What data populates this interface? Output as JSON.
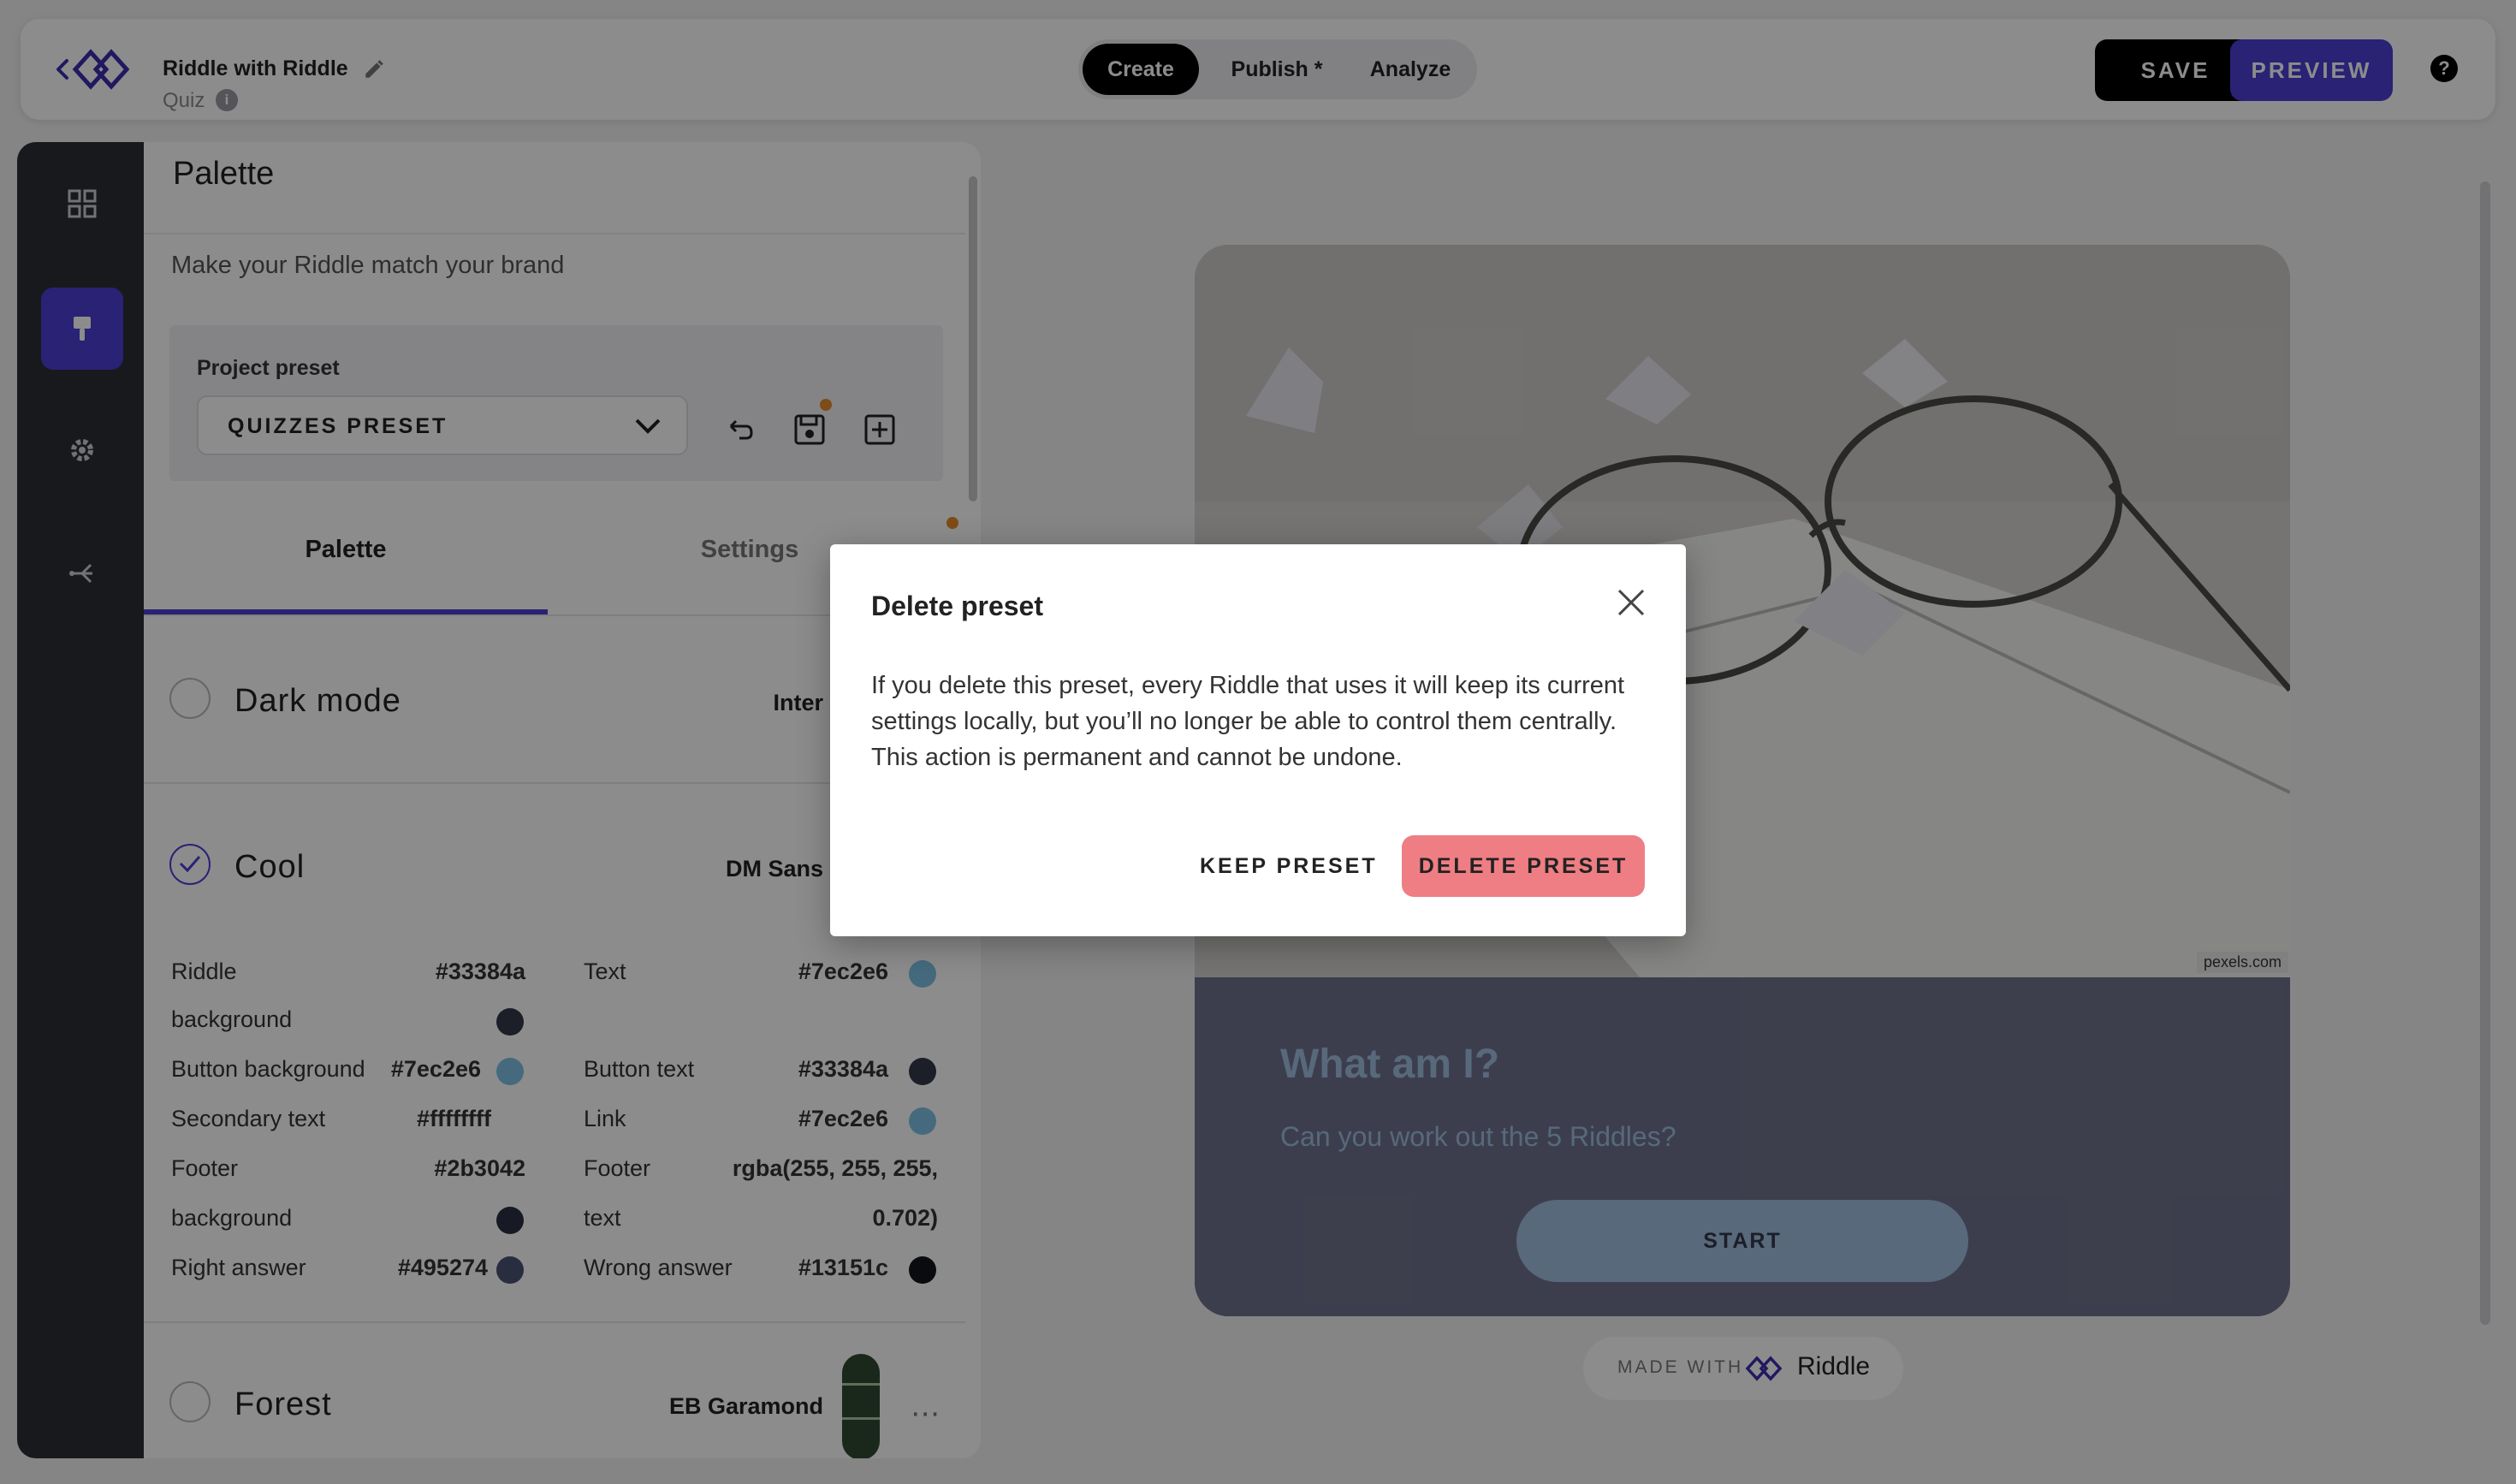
{
  "header": {
    "project_title": "Riddle with Riddle",
    "project_type": "Quiz",
    "tabs": [
      "Create",
      "Publish *",
      "Analyze"
    ],
    "save_label": "SAVE",
    "preview_label": "PREVIEW"
  },
  "panel": {
    "title": "Palette",
    "subtitle": "Make your Riddle match your brand",
    "preset_label": "Project preset",
    "preset_value": "QUIZZES PRESET",
    "tabs": [
      "Palette",
      "Settings"
    ]
  },
  "themes": [
    {
      "name": "Dark mode",
      "font": "Inter",
      "selected": false
    },
    {
      "name": "Cool",
      "font": "DM Sans",
      "selected": true
    },
    {
      "name": "Forest",
      "font": "EB Garamond",
      "selected": false
    }
  ],
  "colors": {
    "riddle_bg_label_1": "Riddle",
    "riddle_bg_label_2": "background",
    "riddle_bg_value": "#33384a",
    "text_label": "Text",
    "text_value": "#7ec2e6",
    "button_bg_label": "Button background",
    "button_bg_value": "#7ec2e6",
    "button_text_label": "Button text",
    "button_text_value": "#33384a",
    "secondary_label": "Secondary text",
    "secondary_value": "#ffffffff",
    "link_label": "Link",
    "link_value": "#7ec2e6",
    "footer_bg_label_1": "Footer",
    "footer_bg_label_2": "background",
    "footer_bg_value": "#2b3042",
    "footer_text_label_1": "Footer",
    "footer_text_label_2": "text",
    "footer_text_value_1": "rgba(255, 255, 255,",
    "footer_text_value_2": "0.702)",
    "right_label": "Right answer",
    "right_value": "#495274",
    "wrong_label": "Wrong answer",
    "wrong_value": "#13151c"
  },
  "preview": {
    "credit": "pexels.com",
    "question": "What am I?",
    "subtitle": "Can you work out the 5 Riddles?",
    "start_label": "START",
    "made_with": "MADE WITH",
    "brand": "Riddle"
  },
  "modal": {
    "title": "Delete preset",
    "body": "If you delete this preset, every Riddle that uses it will keep its current settings locally, but you’ll no longer be able to control them centrally. This action is permanent and cannot be undone.",
    "keep_label": "KEEP PRESET",
    "delete_label": "DELETE PRESET"
  },
  "accent_colors": {
    "brand": "#4b3fd6",
    "danger": "#ee7e83",
    "rail": "#2c2e36"
  }
}
